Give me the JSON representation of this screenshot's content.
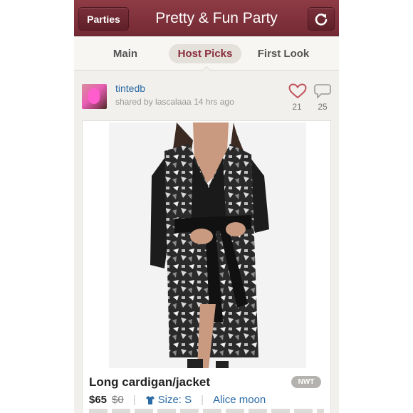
{
  "header": {
    "left_button": "Parties",
    "title": "Pretty & Fun Party",
    "right_icon": "refresh-icon"
  },
  "tabs": [
    {
      "label": "Main",
      "active": false
    },
    {
      "label": "Host Picks",
      "active": true
    },
    {
      "label": "First Look",
      "active": false
    }
  ],
  "post": {
    "username": "tintedb",
    "shared_line": "shared by lascalaaa 14 hrs ago",
    "likes": "21",
    "comments": "25",
    "like_icon": "heart-icon",
    "comment_icon": "speech-bubble-icon"
  },
  "listing": {
    "title": "Long cardigan/jacket",
    "condition_badge": "NWT",
    "price": "$65",
    "original_price": "$0",
    "size": "Size: S",
    "brand": "Alice moon"
  },
  "colors": {
    "header": "#7e303b",
    "link": "#2a6aa5",
    "active_tab_text": "#8a2d3a",
    "heart": "#c0505a"
  }
}
